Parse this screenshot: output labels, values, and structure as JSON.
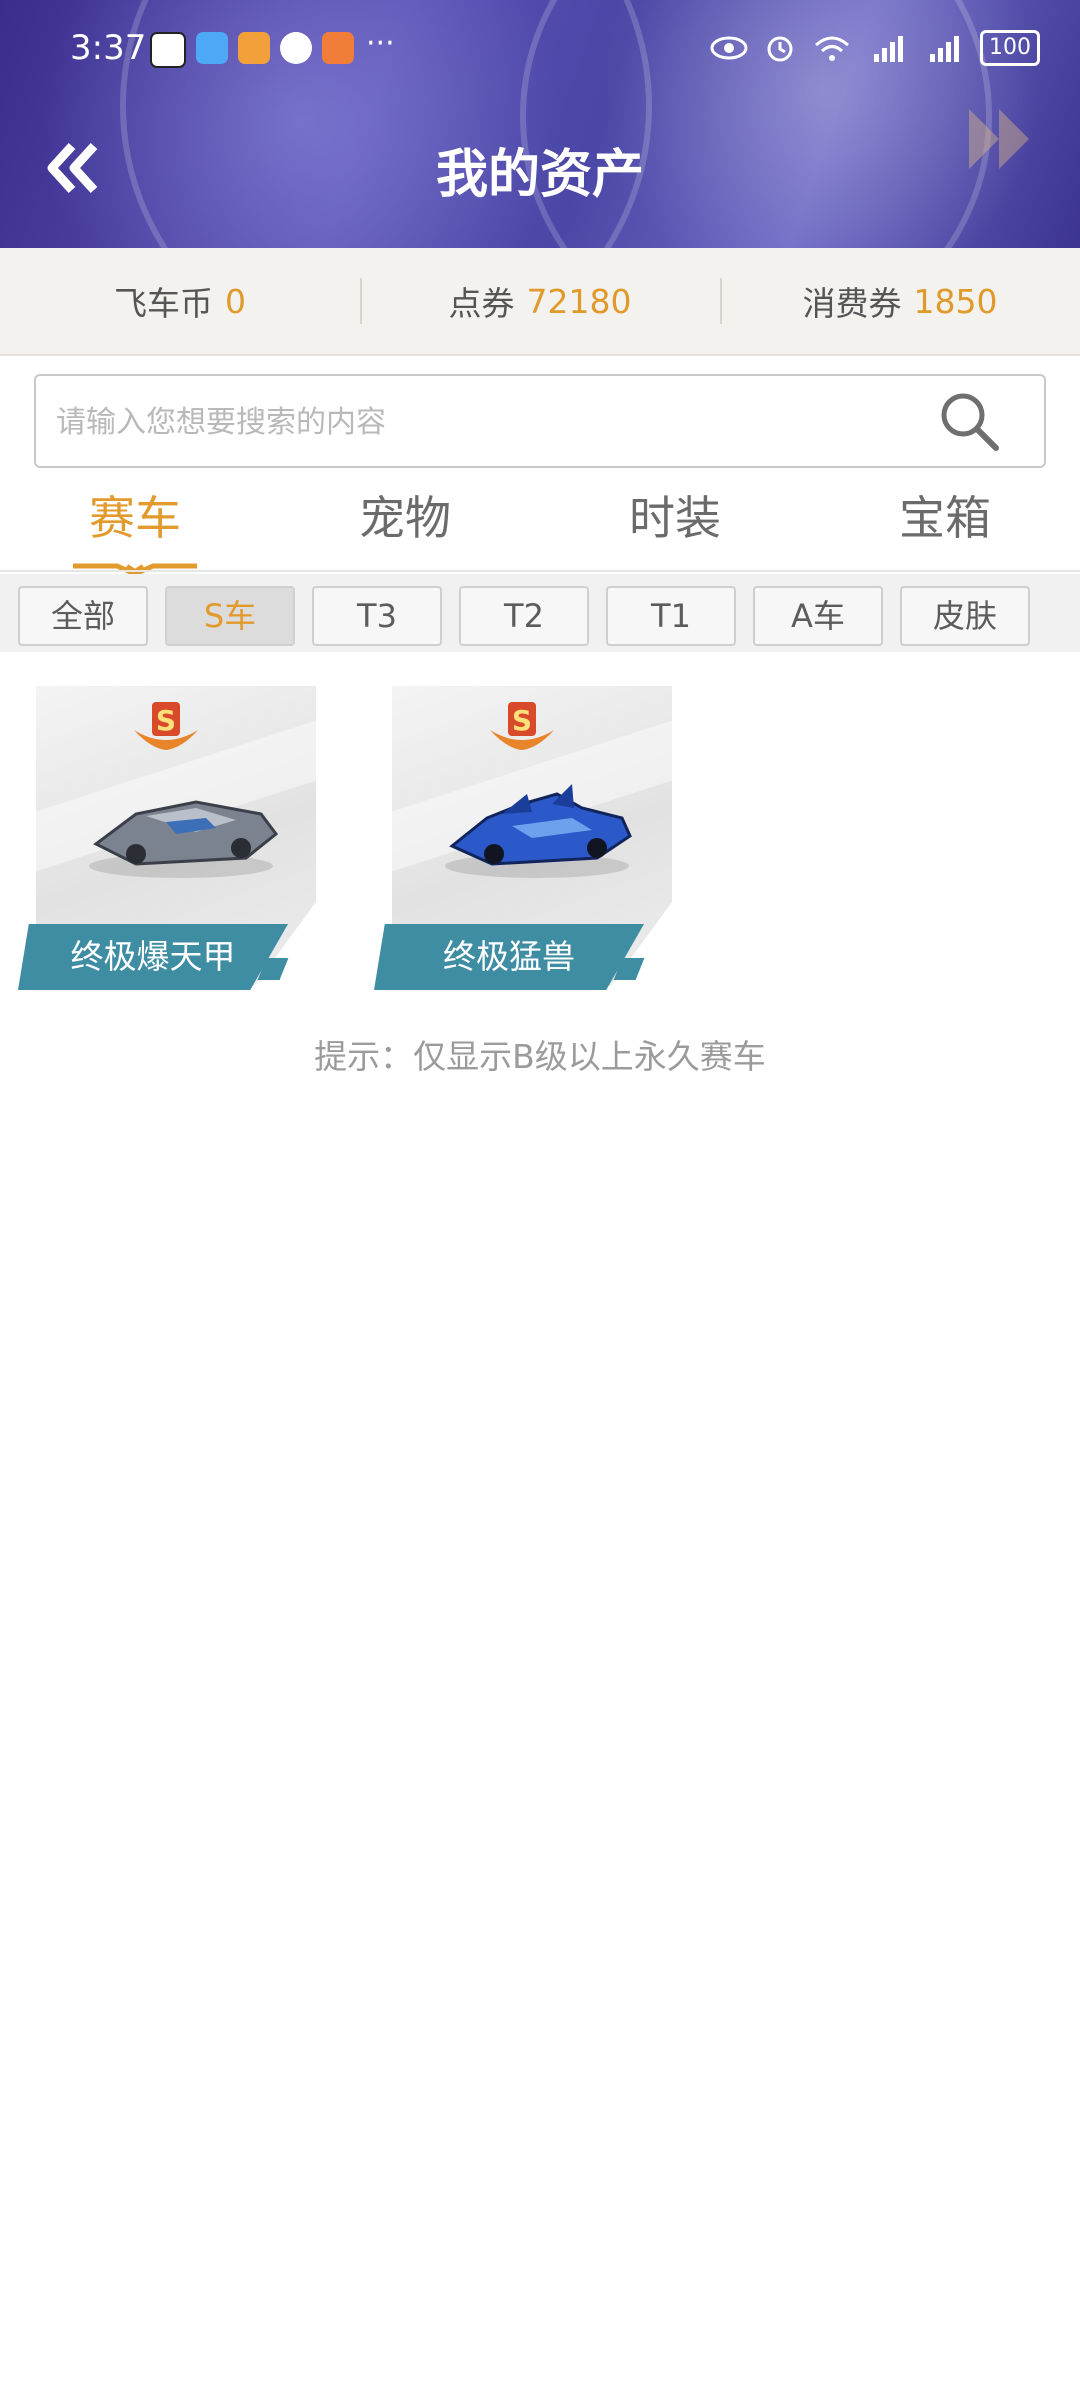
{
  "status_bar": {
    "time": "3:37",
    "more": "···",
    "battery": "100"
  },
  "header": {
    "title": "我的资产",
    "back_icon": "double-chevron-left"
  },
  "balances": [
    {
      "label": "飞车币",
      "value": "0"
    },
    {
      "label": "点券",
      "value": "72180"
    },
    {
      "label": "消费券",
      "value": "1850"
    }
  ],
  "search": {
    "placeholder": "请输入您想要搜索的内容"
  },
  "tabs": [
    {
      "label": "赛车",
      "active": true
    },
    {
      "label": "宠物",
      "active": false
    },
    {
      "label": "时装",
      "active": false
    },
    {
      "label": "宝箱",
      "active": false
    }
  ],
  "filters": [
    {
      "label": "全部",
      "active": false
    },
    {
      "label": "S车",
      "active": true
    },
    {
      "label": "T3",
      "active": false
    },
    {
      "label": "T2",
      "active": false
    },
    {
      "label": "T1",
      "active": false
    },
    {
      "label": "A车",
      "active": false
    },
    {
      "label": "皮肤",
      "active": false
    }
  ],
  "items": [
    {
      "name": "终极爆天甲",
      "grade": "S",
      "car_color": "#6f7784"
    },
    {
      "name": "终极猛兽",
      "grade": "S",
      "car_color": "#2b59c9"
    }
  ],
  "hint": "提示：仅显示B级以上永久赛车",
  "colors": {
    "accent": "#e39a2d",
    "label_bg": "#3f8da3"
  }
}
